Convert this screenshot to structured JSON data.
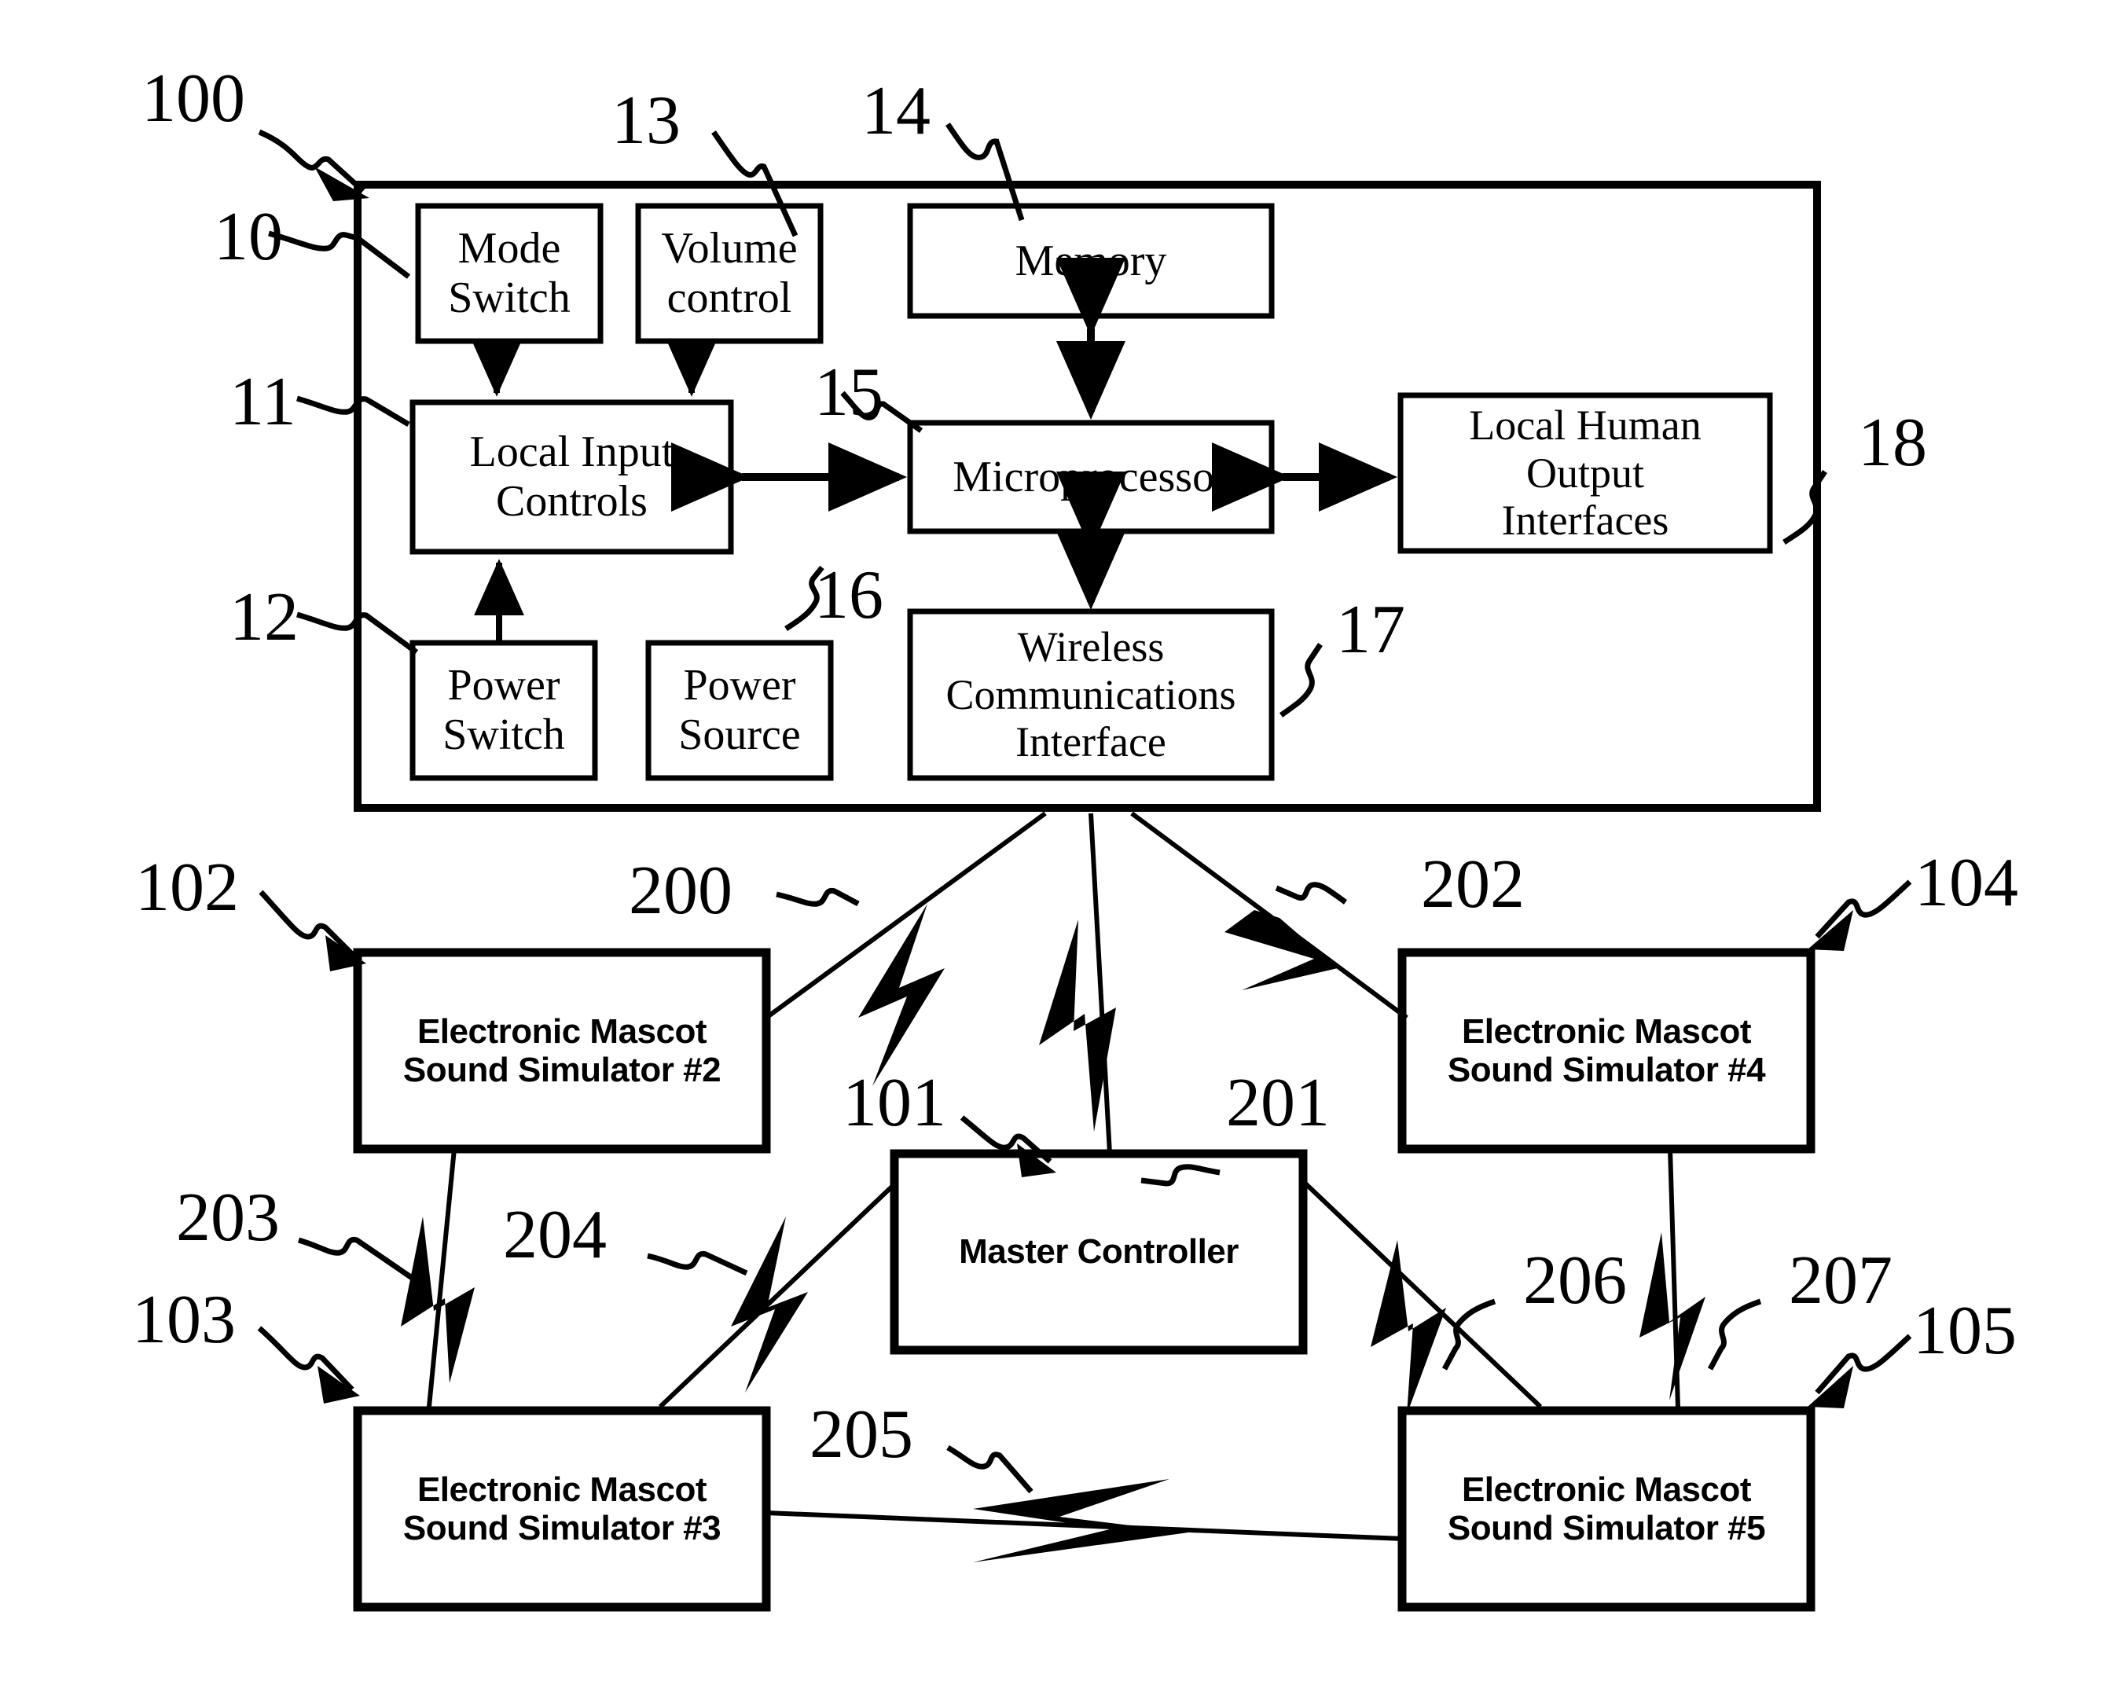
{
  "figure": {
    "type": "patent-block-diagram",
    "line_color": "#000000",
    "background": "#ffffff"
  },
  "outer_enclosure": {
    "ref": "100",
    "left_edge_ref": "10"
  },
  "upper_blocks": [
    {
      "id": "mode-switch",
      "label": "Mode\nSwitch"
    },
    {
      "id": "volume-control",
      "label": "Volume\ncontrol",
      "ref": "13"
    },
    {
      "id": "memory",
      "label": "Memory",
      "ref": "14"
    },
    {
      "id": "local-input-controls",
      "label": "Local Input\nControls",
      "ref": "11"
    },
    {
      "id": "microprocessor",
      "label": "Microprocessor",
      "ref": "15"
    },
    {
      "id": "local-human-output",
      "label": "Local Human\nOutput\nInterfaces",
      "ref": "18"
    },
    {
      "id": "power-switch",
      "label": "Power\nSwitch",
      "ref": "12"
    },
    {
      "id": "power-source",
      "label": "Power\nSource",
      "ref": "16"
    },
    {
      "id": "wireless-comms",
      "label": "Wireless\nCommunications\nInterface",
      "ref": "17"
    }
  ],
  "lower_blocks": [
    {
      "id": "mascot-2",
      "label": "Electronic Mascot\nSound Simulator #2",
      "ref": "102"
    },
    {
      "id": "mascot-4",
      "label": "Electronic Mascot\nSound Simulator #4",
      "ref": "104"
    },
    {
      "id": "mascot-3",
      "label": "Electronic Mascot\nSound Simulator #3",
      "ref": "103"
    },
    {
      "id": "mascot-5",
      "label": "Electronic Mascot\nSound Simulator #5",
      "ref": "105"
    },
    {
      "id": "master-controller",
      "label": "Master Controller",
      "ref": "101"
    }
  ],
  "reference_numerals": {
    "n100": "100",
    "n10": "10",
    "n11": "11",
    "n12": "12",
    "n13": "13",
    "n14": "14",
    "n15": "15",
    "n16": "16",
    "n17": "17",
    "n18": "18",
    "n101": "101",
    "n102": "102",
    "n103": "103",
    "n104": "104",
    "n105": "105",
    "n200": "200",
    "n201": "201",
    "n202": "202",
    "n203": "203",
    "n204": "204",
    "n205": "205",
    "n206": "206",
    "n207": "207"
  },
  "wireless_links": [
    {
      "ref": "200",
      "from": "wireless-comms",
      "to": "mascot-2"
    },
    {
      "ref": "201",
      "from": "wireless-comms",
      "to": "master-controller"
    },
    {
      "ref": "202",
      "from": "wireless-comms",
      "to": "mascot-4"
    },
    {
      "ref": "203",
      "from": "mascot-2",
      "to": "mascot-3"
    },
    {
      "ref": "204",
      "from": "mascot-3",
      "to": "master-controller"
    },
    {
      "ref": "205",
      "from": "mascot-3",
      "to": "mascot-5"
    },
    {
      "ref": "206",
      "from": "master-controller",
      "to": "mascot-5"
    },
    {
      "ref": "207",
      "from": "mascot-4",
      "to": "mascot-5"
    }
  ]
}
